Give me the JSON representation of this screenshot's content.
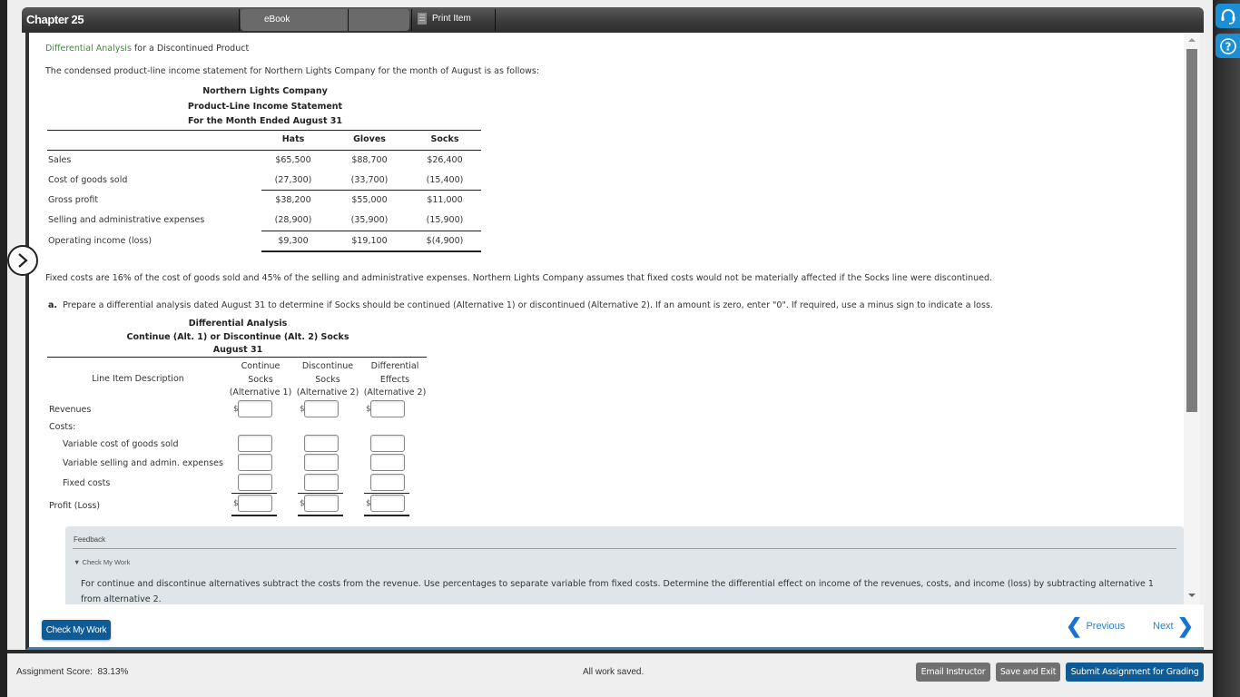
{
  "header": {
    "chapter": "Chapter 25",
    "tabs": [
      {
        "label": "eBook"
      },
      {
        "label": ""
      }
    ],
    "print_label": "Print Item"
  },
  "question": {
    "topic_link": "Differential Analysis",
    "topic_rest": " for a Discontinued Product",
    "intro": "The condensed product-line income statement for Northern Lights Company for the month of August is as follows:",
    "statement": {
      "title1": "Northern Lights Company",
      "title2": "Product-Line Income Statement",
      "title3": "For the Month Ended August 31",
      "columns": [
        "Hats",
        "Gloves",
        "Socks"
      ],
      "rows": [
        {
          "label": "Sales",
          "values": [
            "$65,500",
            "$88,700",
            "$26,400"
          ]
        },
        {
          "label": "Cost of goods sold",
          "values": [
            "(27,300)",
            "(33,700)",
            "(15,400)"
          ]
        },
        {
          "label": "Gross profit",
          "values": [
            "$38,200",
            "$55,000",
            "$11,000"
          ]
        },
        {
          "label": "Selling and administrative expenses",
          "values": [
            "(28,900)",
            "(35,900)",
            "(15,900)"
          ]
        },
        {
          "label": "Operating income (loss)",
          "values": [
            "$9,300",
            "$19,100",
            "$(4,900)"
          ]
        }
      ]
    },
    "fixed_costs_text": "Fixed costs are 16% of the cost of goods sold and 45% of the selling and administrative expenses. Northern Lights Company assumes that fixed costs would not be materially affected if the Socks line were discontinued.",
    "part_a_letter": "a.",
    "part_a_text": "Prepare a differential analysis dated August 31 to determine if Socks should be continued (Alternative 1) or discontinued (Alternative 2). If an amount is zero, enter \"0\". If required, use a minus sign to indicate a loss."
  },
  "analysis": {
    "title1": "Differential Analysis",
    "title2": "Continue (Alt. 1) or Discontinue (Alt. 2) Socks",
    "title3": "August 31",
    "desc_header": "Line Item Description",
    "col_headers": [
      [
        "Continue",
        "Socks",
        "(Alternative 1)"
      ],
      [
        "Discontinue",
        "Socks",
        "(Alternative 2)"
      ],
      [
        "Differential",
        "Effects",
        "(Alternative 2)"
      ]
    ],
    "currency": "$",
    "rows": {
      "revenues": {
        "label": "Revenues",
        "values": [
          "",
          "",
          ""
        ]
      },
      "costs_label": "Costs:",
      "var_cogs": {
        "label": "Variable cost of goods sold",
        "values": [
          "",
          "",
          ""
        ]
      },
      "var_sga": {
        "label": "Variable selling and admin. expenses",
        "values": [
          "",
          "",
          ""
        ]
      },
      "fixed": {
        "label": "Fixed costs",
        "values": [
          "",
          "",
          ""
        ]
      },
      "profit": {
        "label": "Profit (Loss)",
        "values": [
          "",
          "",
          ""
        ]
      }
    }
  },
  "feedback": {
    "label": "Feedback",
    "toggle": "Check My Work",
    "text": "For continue and discontinue alternatives subtract the costs from the revenue. Use percentages to separate variable from fixed costs. Determine the differential effect on income of the revenues, costs, and income (loss) by subtracting alternative 1 from alternative 2."
  },
  "footer": {
    "check_my_work": "Check My Work",
    "previous": "Previous",
    "next": "Next",
    "score_label": "Assignment Score:",
    "score_value": "83.13%",
    "saved_status": "All work saved.",
    "email_instructor": "Email Instructor",
    "save_exit": "Save and Exit",
    "submit": "Submit Assignment for Grading"
  },
  "colors": {
    "accent_blue": "#0e5b95",
    "link_green": "#3d8b3d",
    "rail_blue": "#1a8fd6"
  }
}
